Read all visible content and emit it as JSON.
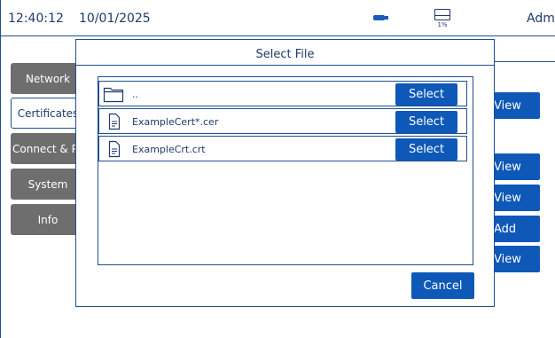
{
  "header": {
    "time": "12:40:12",
    "date": "10/01/2025",
    "user": "Admin",
    "storage_percent": "1%",
    "usb_icon": "usb-drive-icon",
    "storage_icon": "storage-drive-icon"
  },
  "sidebar": {
    "tabs": [
      {
        "label": "Network"
      },
      {
        "label": "Certificates",
        "active": true
      },
      {
        "label": "Connect & Print"
      },
      {
        "label": "System"
      },
      {
        "label": "Info"
      }
    ]
  },
  "background_buttons": [
    "View",
    "View",
    "View",
    "Add",
    "View"
  ],
  "dialog": {
    "title": "Select File",
    "files": [
      {
        "name": "..",
        "icon": "folder-icon",
        "action": "Select"
      },
      {
        "name": "ExampleCert*.cer",
        "icon": "document-icon",
        "action": "Select"
      },
      {
        "name": "ExampleCrt.crt",
        "icon": "document-icon",
        "action": "Select"
      }
    ],
    "cancel_label": "Cancel"
  },
  "colors": {
    "accent": "#0e58b8",
    "border": "#1f4f8f",
    "text": "#1f3a6b",
    "tab_inactive": "#6e6e6e"
  }
}
